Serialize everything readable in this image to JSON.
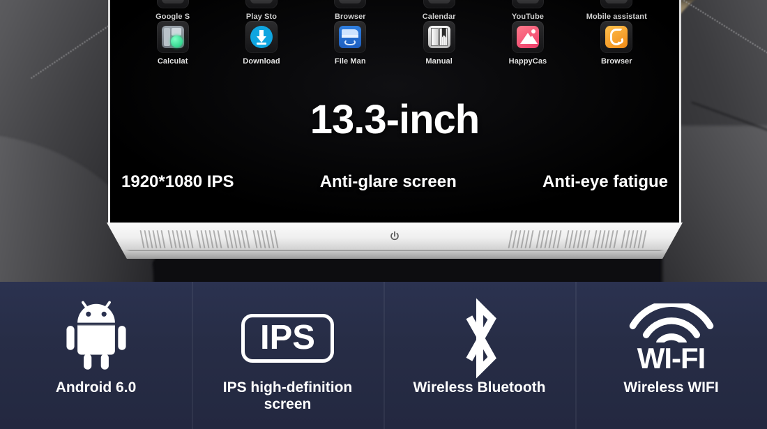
{
  "photo": {
    "monitor": {
      "app_rows": [
        {
          "row": "top-partial",
          "apps": [
            {
              "label": "Google S",
              "icon": "google-search-icon"
            },
            {
              "label": "Play Sto",
              "icon": "play-store-icon"
            },
            {
              "label": "Browser",
              "icon": "browser-icon"
            },
            {
              "label": "Calendar",
              "icon": "calendar-icon"
            },
            {
              "label": "YouTube",
              "icon": "youtube-icon"
            },
            {
              "label": "Mobile assistant",
              "icon": "mobile-assistant-icon"
            }
          ]
        },
        {
          "row": "second",
          "apps": [
            {
              "label": "Calculat",
              "icon": "calculator-icon"
            },
            {
              "label": "Download",
              "icon": "download-icon"
            },
            {
              "label": "File Man",
              "icon": "file-manager-icon"
            },
            {
              "label": "Manual",
              "icon": "manual-book-icon"
            },
            {
              "label": "HappyCas",
              "icon": "happycast-icon"
            },
            {
              "label": "Browser",
              "icon": "uc-browser-icon"
            }
          ]
        }
      ],
      "headline": "13.3-inch",
      "specs": [
        "1920*1080 IPS",
        "Anti-glare screen",
        "Anti-eye fatigue"
      ],
      "power_button": "power-icon"
    }
  },
  "features": [
    {
      "icon": "android-robot-icon",
      "label": "Android 6.0"
    },
    {
      "icon": "ips-badge-icon",
      "badge_text": "IPS",
      "label": "IPS high-definition screen"
    },
    {
      "icon": "bluetooth-icon",
      "label": "Wireless Bluetooth"
    },
    {
      "icon": "wifi-icon",
      "badge_text": "WI-FI",
      "label": "Wireless WIFI"
    }
  ],
  "colors": {
    "panel_bg": "#272d46",
    "screen_bg": "#000000",
    "bezel": "#f2f2f2",
    "text_white": "#ffffff"
  }
}
